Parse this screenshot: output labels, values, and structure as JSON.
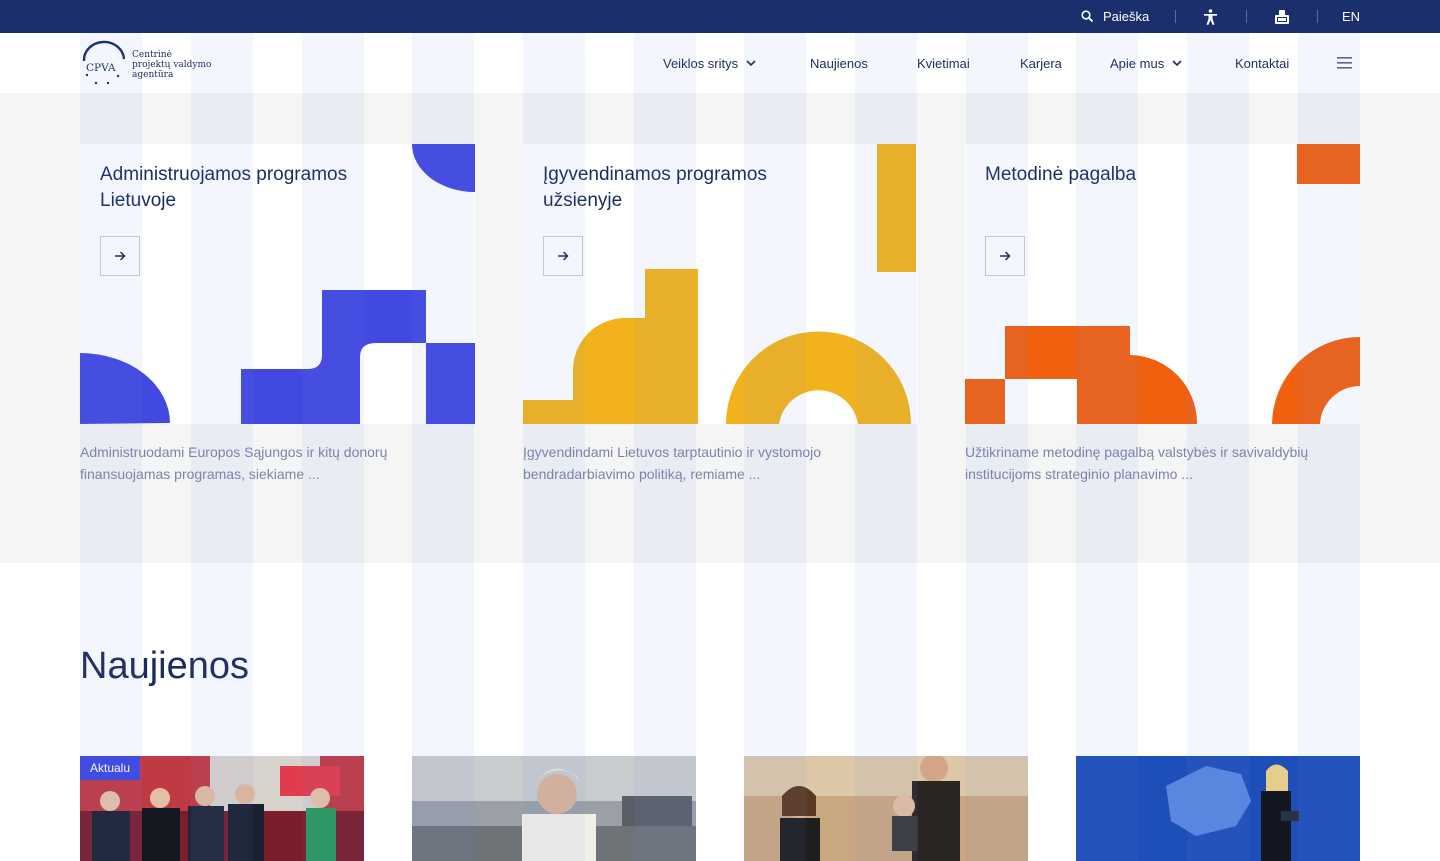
{
  "topbar": {
    "search_label": "Paieška",
    "accessibility_icon": "accessibility-icon",
    "sign_language_icon": "sign-language-icon",
    "language": "EN"
  },
  "header": {
    "logo": {
      "abbr": "CPVA",
      "line1": "Centrinė",
      "line2": "projektų valdymo",
      "line3": "agentūra"
    },
    "nav": [
      {
        "label": "Veiklos sritys"
      },
      {
        "label": "Naujienos"
      },
      {
        "label": "Kvietimai"
      },
      {
        "label": "Karjera"
      },
      {
        "label": "Apie mus"
      },
      {
        "label": "Kontaktai"
      }
    ],
    "menu_icon": "hamburger-icon"
  },
  "services": [
    {
      "title": "Administruojamos programos Lietuvoje",
      "description": "Administruodami Europos Sąjungos ir kitų donorų finansuojamas programas, siekiame ...",
      "color": "#4249e0"
    },
    {
      "title": "Įgyvendinamos programos užsienyje",
      "description": "Įgyvendindami Lietuvos tarptautinio ir vystomojo bendradarbiavimo politiką, remiame ...",
      "color": "#f2b21b"
    },
    {
      "title": "Metodinė pagalba",
      "description": "Užtikriname metodinę pagalbą valstybės ir savivaldybių institucijoms strateginio planavimo ...",
      "color": "#f0610f"
    }
  ],
  "news": {
    "title": "Naujienos",
    "badge": "Aktualu",
    "cards": [
      {
        "image": "panel-discussion-photo"
      },
      {
        "image": "man-portrait-street-photo"
      },
      {
        "image": "family-outdoor-photo"
      },
      {
        "image": "speaker-presentation-photo"
      }
    ]
  },
  "colors": {
    "navy": "#1a2f6b",
    "blue": "#4249e0",
    "yellow": "#f2b21b",
    "orange": "#f0610f"
  }
}
